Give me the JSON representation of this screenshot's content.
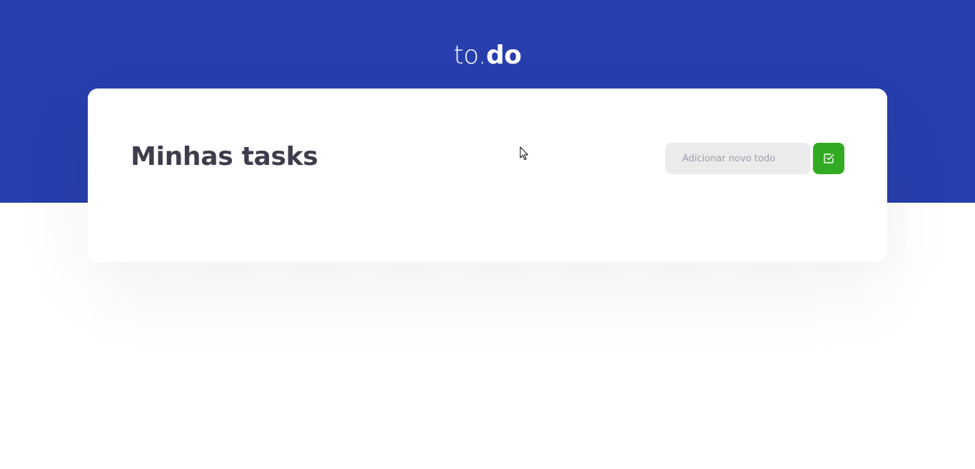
{
  "app": {
    "logo_prefix": "to.",
    "logo_bold": "do"
  },
  "colors": {
    "header_background": "#273fad",
    "accent_green": "#33aa23",
    "title_text": "#3d3d4d",
    "input_background": "#ebebeb"
  },
  "tasks": {
    "heading": "Minhas tasks",
    "new_todo_input": {
      "placeholder": "Adicionar novo todo",
      "value": ""
    },
    "add_button": {
      "icon": "check-square-icon"
    },
    "items": []
  }
}
